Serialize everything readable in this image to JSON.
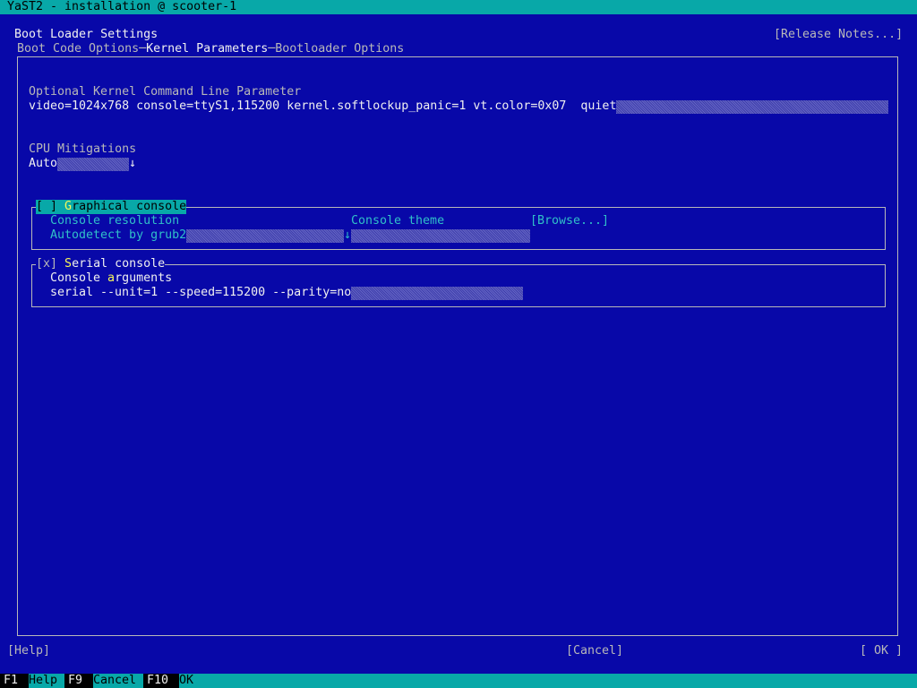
{
  "window": {
    "title": "YaST2 - installation @ scooter-1"
  },
  "header": {
    "title": "Boot Loader Settings",
    "release_notes": "[Release Notes...]"
  },
  "tabs": [
    {
      "label": "Boot Code Options",
      "active": false
    },
    {
      "label": "Kernel Parameters",
      "active": true
    },
    {
      "label": "Bootloader Options",
      "active": false
    }
  ],
  "kernel_params": {
    "label": "Optional Kernel Command Line Parameter",
    "value": "video=1024x768 console=ttyS1,115200 kernel.softlockup_panic=1 vt.color=0x07  quiet"
  },
  "cpu_mitigations": {
    "label": "CPU Mitigations",
    "value": "Auto",
    "arrow": "↓"
  },
  "graphical_console": {
    "checkbox": "[ ]",
    "label": "Graphical console",
    "checked": false,
    "resolution_label": "Console resolution",
    "resolution_value": "Autodetect by grub2",
    "resolution_arrow": "↓",
    "theme_label": "Console theme",
    "theme_value": "",
    "browse": "[Browse...]"
  },
  "serial_console": {
    "checkbox": "[x]",
    "label": "Serial console",
    "checked": true,
    "args_label": "Console arguments",
    "args_value": "serial --unit=1 --speed=115200 --parity=no"
  },
  "buttons": {
    "help": "[Help]",
    "cancel": "[Cancel]",
    "ok": "[ OK ]"
  },
  "function_keys": [
    {
      "key": "F1",
      "label": "Help"
    },
    {
      "key": "F9",
      "label": "Cancel"
    },
    {
      "key": "F10",
      "label": "OK"
    }
  ],
  "colors": {
    "background": "#0808a8",
    "title_bar": "#08a8a8",
    "highlight_text": "#f8f858",
    "disabled_text": "#30c0c8"
  }
}
